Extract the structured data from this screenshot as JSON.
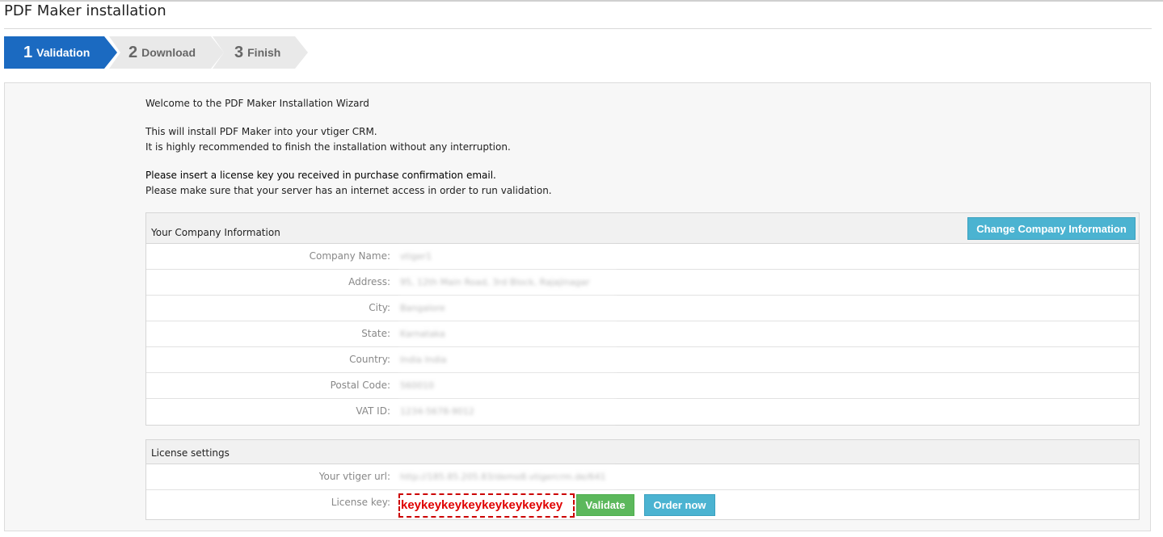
{
  "header": {
    "title": "PDF Maker installation"
  },
  "steps": [
    {
      "number": "1",
      "label": "Validation",
      "active": true
    },
    {
      "number": "2",
      "label": "Download",
      "active": false
    },
    {
      "number": "3",
      "label": "Finish",
      "active": false
    }
  ],
  "intro": {
    "welcome": "Welcome to the PDF Maker Installation Wizard",
    "line1": "This will install PDF Maker into your vtiger CRM.",
    "line2": "It is highly recommended to finish the installation without any interruption.",
    "line3": "Please insert a license key you received in purchase confirmation email.",
    "line4": "Please make sure that your server has an internet access in order to run validation."
  },
  "company": {
    "title": "Your Company Information",
    "change_button": "Change Company Information",
    "fields": [
      {
        "label": "Company Name:",
        "value": "vtiger1"
      },
      {
        "label": "Address:",
        "value": "95, 12th Main Road, 3rd Block, Rajajinagar"
      },
      {
        "label": "City:",
        "value": "Bangalore"
      },
      {
        "label": "State:",
        "value": "Karnataka"
      },
      {
        "label": "Country:",
        "value": "India India"
      },
      {
        "label": "Postal Code:",
        "value": "560010"
      },
      {
        "label": "VAT ID:",
        "value": "1234-5678-9012"
      }
    ]
  },
  "license": {
    "title": "License settings",
    "url_label": "Your vtiger url:",
    "url_value": "http://185.85.205.83/demo8.vtigercrm.de/641",
    "key_label": "License key:",
    "key_value": "keykeykeykeykeykeykeykey",
    "validate_button": "Validate",
    "order_button": "Order now"
  },
  "colors": {
    "active_step": "#1b6ac1",
    "info_button": "#4bb3d1",
    "validate_button": "#5cb85c",
    "license_key_text": "#e00000"
  }
}
